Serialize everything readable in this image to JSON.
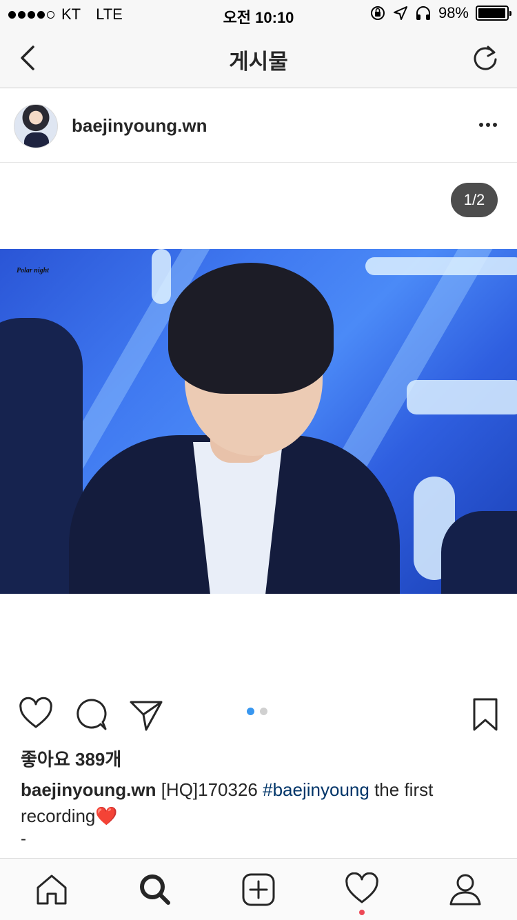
{
  "status_bar": {
    "carrier": "KT",
    "network": "LTE",
    "time": "오전 10:10",
    "battery_text": "98%",
    "battery_level": 0.98,
    "signal_bars_filled": 4,
    "signal_bars_total": 5
  },
  "nav": {
    "title": "게시물",
    "back_icon": "chevron-left-icon",
    "refresh_icon": "refresh-icon"
  },
  "post": {
    "username": "baejinyoung.wn",
    "page_indicator": "1/2",
    "photo_watermark": "Polar night",
    "carousel_count": 2,
    "carousel_active": 1,
    "likes": "좋아요 389개",
    "caption": {
      "username": "baejinyoung.wn",
      "text_before": "[HQ]170326",
      "hashtag": "#baejinyoung",
      "text_after": "the first recording",
      "emoji": "❤️",
      "second_line": "-"
    }
  },
  "colors": {
    "accent_blue": "#3897f0",
    "hashtag": "#003569",
    "notification": "#ed4956",
    "text": "#262626"
  },
  "tab_bar": {
    "items": [
      "home-icon",
      "search-icon",
      "add-post-icon",
      "activity-heart-icon",
      "profile-icon"
    ]
  }
}
